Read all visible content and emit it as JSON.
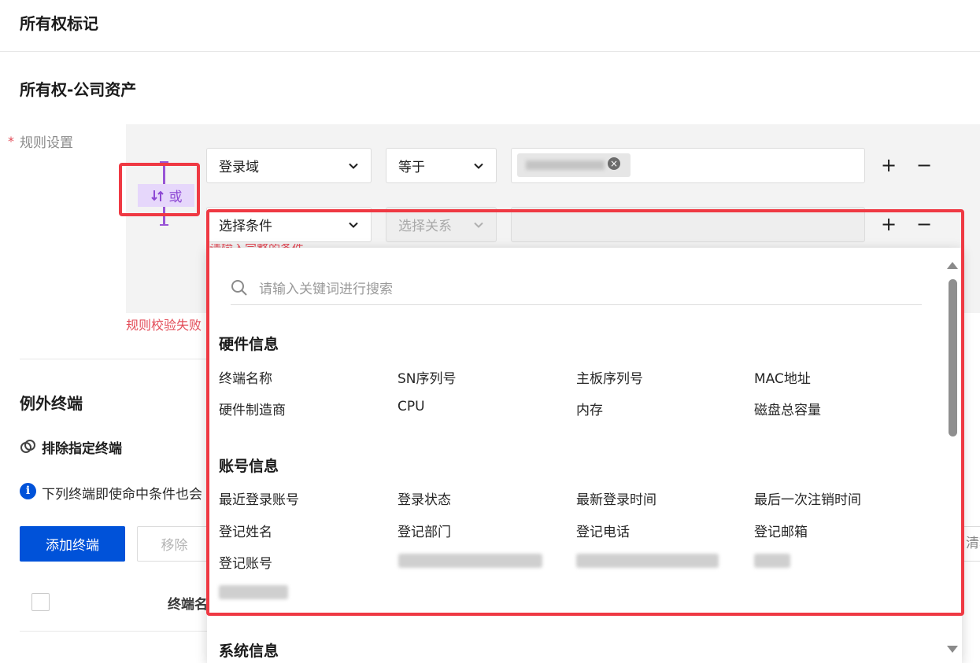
{
  "page_title": "所有权标记",
  "section_title": "所有权-公司资产",
  "rule": {
    "required_mark": "*",
    "label": "规则设置",
    "logic_operator": "或",
    "rows": [
      {
        "condition": "登录域",
        "relation": "等于",
        "value_tag": "",
        "placeholder_condition": "",
        "placeholder_relation": ""
      },
      {
        "condition": "选择条件",
        "relation": "选择关系",
        "value_tag": ""
      }
    ],
    "add_symbol": "+",
    "remove_symbol": "−",
    "row_error": "请输入完整的条件",
    "rule_error": "规则校验失败"
  },
  "exceptions": {
    "title": "例外终端",
    "subtitle": "排除指定终端",
    "info_icon_glyph": "i",
    "info_text": "下列终端即使命中条件也会",
    "add_button": "添加终端",
    "remove_button": "移除",
    "right_partial": "清输",
    "table_header_name": "终端名"
  },
  "dropdown": {
    "search_placeholder": "请输入关键词进行搜索",
    "groups": [
      {
        "title": "硬件信息",
        "items": [
          "终端名称",
          "SN序列号",
          "主板序列号",
          "MAC地址",
          "硬件制造商",
          "CPU",
          "内存",
          "磁盘总容量"
        ]
      },
      {
        "title": "账号信息",
        "items": [
          "最近登录账号",
          "登录状态",
          "最新登录时间",
          "最后一次注销时间",
          "登记姓名",
          "登记部门",
          "登记电话",
          "登记邮箱",
          "登记账号"
        ]
      },
      {
        "title": "系统信息",
        "items": []
      }
    ]
  },
  "colors": {
    "primary": "#0052d9",
    "error": "#e34d59",
    "logic_purple": "#8d48d4",
    "highlight_red": "#ef3943"
  },
  "icons": [
    "chevron-down-icon",
    "clear-icon",
    "search-icon",
    "link-icon",
    "info-icon",
    "switch-icon"
  ]
}
